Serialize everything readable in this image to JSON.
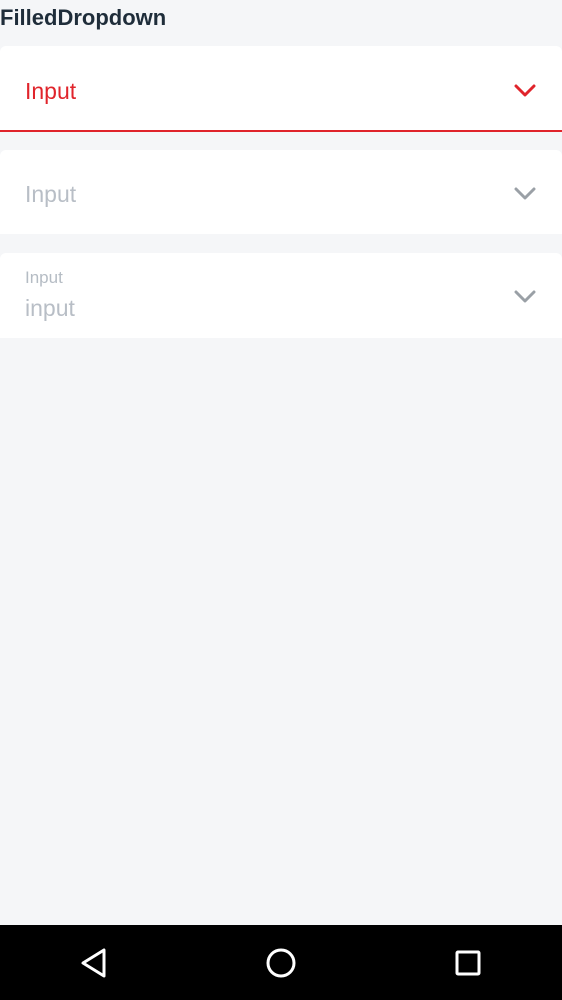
{
  "page": {
    "title": "FilledDropdown"
  },
  "colors": {
    "accent": "#e0242b",
    "placeholder": "#b8bec6",
    "surface": "#ffffff",
    "background": "#f5f6f8",
    "chevron_default": "#9aa0a6"
  },
  "dropdowns": [
    {
      "state": "focused",
      "value": "Input",
      "icon": "chevron-down-icon"
    },
    {
      "state": "default",
      "value": "Input",
      "icon": "chevron-down-icon"
    },
    {
      "state": "filled-with-label",
      "label": "Input",
      "value": "input",
      "icon": "chevron-down-icon"
    }
  ],
  "system_nav": {
    "back_icon": "back-triangle-icon",
    "home_icon": "home-circle-icon",
    "recents_icon": "recents-square-icon"
  }
}
